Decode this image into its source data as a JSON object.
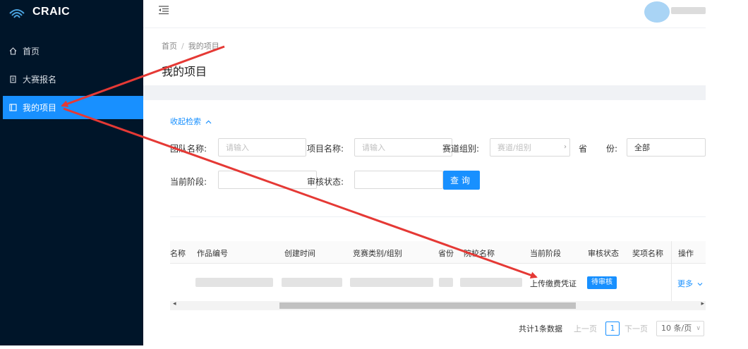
{
  "app": {
    "name": "CRAIC"
  },
  "sidebar": {
    "items": [
      {
        "label": "首页",
        "icon": "home-icon"
      },
      {
        "label": "大赛报名",
        "icon": "signup-icon"
      },
      {
        "label": "我的项目",
        "icon": "project-icon",
        "active": true
      }
    ]
  },
  "breadcrumb": {
    "home": "首页",
    "separator": "/",
    "current": "我的项目"
  },
  "page": {
    "title": "我的项目"
  },
  "search": {
    "collapse_label": "收起检索",
    "team_name_label": "团队名称:",
    "team_name_placeholder": "请输入",
    "project_name_label": "项目名称:",
    "project_name_placeholder": "请输入",
    "track_group_label": "赛道组别:",
    "track_group_placeholder": "赛道/组别",
    "province_label_1": "省",
    "province_label_2": "份:",
    "province_value": "全部",
    "stage_label": "当前阶段:",
    "stage_value": "",
    "review_status_label": "审核状态:",
    "review_status_value": "",
    "query_button": "查询"
  },
  "table": {
    "columns": [
      "名称",
      "作品编号",
      "创建时间",
      "竞赛类别/组别",
      "省份",
      "院校名称",
      "当前阶段",
      "审核状态",
      "奖项名称",
      "操作"
    ],
    "rows": [
      {
        "current_stage": "上传缴费凭证",
        "review_status": "待审核",
        "action": "更多"
      }
    ]
  },
  "pagination": {
    "total_text": "共计1条数据",
    "prev": "上一页",
    "current_page": "1",
    "next": "下一页",
    "page_size": "10 条/页"
  },
  "colors": {
    "sidebar_bg": "#001529",
    "accent": "#1890ff",
    "annotation_arrow": "#e53935"
  }
}
